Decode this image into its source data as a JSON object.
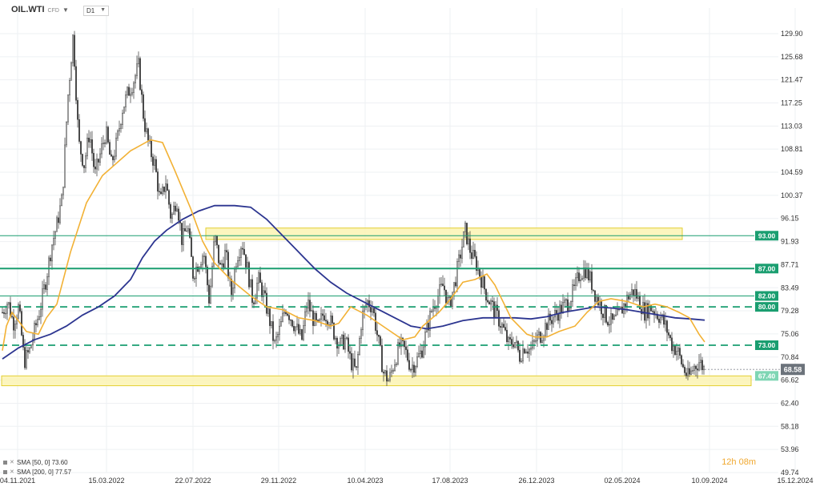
{
  "header": {
    "symbol": "OIL.WTI",
    "symbol_sub": "CFD",
    "timeframe": "D1"
  },
  "indicators": [
    {
      "label": "SMA [50, 0] 73.60",
      "color": "#f2b134"
    },
    {
      "label": "SMA [200, 0] 77.57",
      "color": "#2c3590"
    }
  ],
  "timer": "12h 08m",
  "colors": {
    "candles": "#333333",
    "sma50": "#f2b134",
    "sma200": "#2c3590",
    "level_line": "#1a9e70",
    "zone_fill": "#fbf3b3",
    "zone_border": "#e3cf34"
  },
  "chart_data": {
    "type": "candlestick",
    "title": "",
    "y_ticks": [
      "129.90",
      "125.68",
      "121.47",
      "117.25",
      "113.03",
      "108.81",
      "104.59",
      "100.37",
      "96.15",
      "91.93",
      "87.71",
      "83.49",
      "79.28",
      "75.06",
      "70.84",
      "66.62",
      "62.40",
      "58.18",
      "53.96",
      "49.74"
    ],
    "x_ticks": [
      "04.11.2021",
      "15.03.2022",
      "22.07.2022",
      "29.11.2022",
      "10.04.2023",
      "17.08.2023",
      "26.12.2023",
      "02.05.2024",
      "10.09.2024",
      "15.12.2024"
    ],
    "ylim": [
      49.74,
      131.5
    ],
    "price_levels": [
      {
        "label": "93.00",
        "value": 93.0,
        "style": "solid-thin"
      },
      {
        "label": "87.00",
        "value": 87.0,
        "style": "solid-thick"
      },
      {
        "label": "82.00",
        "value": 82.0,
        "style": "solid-thin"
      },
      {
        "label": "80.00",
        "value": 80.0,
        "style": "dashed"
      },
      {
        "label": "73.00",
        "value": 73.0,
        "style": "dashed"
      },
      {
        "label": "67.40",
        "value": 67.4,
        "style": "zone-top"
      }
    ],
    "current_price": "68.58",
    "zones": [
      {
        "from": 92.3,
        "to": 94.4,
        "start": "2022-07",
        "end": "2024-10"
      },
      {
        "from": 65.6,
        "to": 67.4,
        "start": "2021-11",
        "end": "2024-11"
      }
    ],
    "close_path": [
      79.0,
      81.0,
      77.0,
      80.0,
      70.0,
      72.0,
      76.0,
      80.0,
      85.0,
      91.0,
      95.0,
      100.0,
      118.0,
      129.9,
      110.0,
      106.0,
      112.0,
      104.0,
      108.0,
      112.0,
      106.0,
      110.0,
      116.0,
      119.0,
      121.0,
      124.0,
      114.0,
      109.0,
      106.0,
      99.0,
      103.0,
      96.0,
      100.0,
      92.0,
      95.0,
      86.0,
      88.0,
      90.0,
      81.0,
      93.0,
      87.0,
      90.0,
      82.0,
      89.0,
      92.0,
      87.0,
      81.0,
      85.0,
      82.0,
      78.0,
      73.0,
      76.0,
      80.0,
      78.0,
      76.0,
      74.0,
      81.0,
      78.0,
      76.0,
      79.0,
      78.0,
      75.0,
      73.0,
      74.0,
      70.0,
      68.0,
      78.0,
      81.0,
      80.0,
      74.0,
      68.0,
      66.5,
      70.0,
      73.0,
      72.0,
      69.0,
      70.0,
      72.0,
      76.0,
      80.0,
      82.0,
      84.0,
      80.0,
      84.0,
      89.0,
      94.0,
      90.0,
      88.0,
      85.0,
      82.0,
      80.0,
      78.0,
      76.0,
      73.0,
      74.0,
      71.0,
      73.0,
      72.0,
      74.0,
      75.0,
      77.0,
      78.0,
      79.0,
      80.0,
      81.0,
      83.0,
      86.0,
      87.0,
      85.0,
      82.0,
      80.0,
      78.0,
      77.0,
      78.0,
      80.0,
      82.0,
      83.0,
      81.0,
      79.0,
      80.0,
      79.0,
      78.0,
      76.0,
      73.0,
      72.0,
      69.0,
      67.0,
      69.0,
      70.0,
      68.6
    ],
    "sma50": [
      [
        0,
        72.0
      ],
      [
        5,
        76.5
      ],
      [
        12,
        79.0
      ],
      [
        25,
        76.5
      ],
      [
        30,
        75.5
      ],
      [
        45,
        75.0
      ],
      [
        55,
        78.0
      ],
      [
        68,
        80.5
      ],
      [
        85,
        90.0
      ],
      [
        105,
        99.0
      ],
      [
        125,
        104.0
      ],
      [
        160,
        108.5
      ],
      [
        185,
        110.5
      ],
      [
        200,
        110.0
      ],
      [
        215,
        105.0
      ],
      [
        235,
        98.0
      ],
      [
        250,
        92.0
      ],
      [
        265,
        88.0
      ],
      [
        285,
        85.0
      ],
      [
        310,
        82.0
      ],
      [
        330,
        80.0
      ],
      [
        350,
        79.5
      ],
      [
        370,
        78.0
      ],
      [
        390,
        77.5
      ],
      [
        410,
        76.5
      ],
      [
        420,
        77.0
      ],
      [
        435,
        80.0
      ],
      [
        455,
        78.5
      ],
      [
        480,
        76.0
      ],
      [
        500,
        74.0
      ],
      [
        515,
        74.5
      ],
      [
        525,
        76.5
      ],
      [
        545,
        79.0
      ],
      [
        560,
        81.5
      ],
      [
        575,
        84.5
      ],
      [
        590,
        85.0
      ],
      [
        605,
        86.0
      ],
      [
        615,
        84.0
      ],
      [
        625,
        81.0
      ],
      [
        635,
        78.0
      ],
      [
        645,
        76.5
      ],
      [
        655,
        75.0
      ],
      [
        665,
        74.5
      ],
      [
        680,
        74.5
      ],
      [
        695,
        75.5
      ],
      [
        715,
        76.5
      ],
      [
        730,
        79.0
      ],
      [
        745,
        81.0
      ],
      [
        760,
        81.5
      ],
      [
        780,
        81.0
      ],
      [
        800,
        80.0
      ],
      [
        815,
        80.5
      ],
      [
        830,
        80.0
      ],
      [
        845,
        79.0
      ],
      [
        858,
        78.0
      ],
      [
        870,
        75.0
      ],
      [
        877,
        73.6
      ]
    ],
    "sma200": [
      [
        0,
        70.5
      ],
      [
        20,
        72.5
      ],
      [
        40,
        74.0
      ],
      [
        60,
        75.0
      ],
      [
        80,
        76.5
      ],
      [
        100,
        78.5
      ],
      [
        120,
        80.0
      ],
      [
        140,
        82.0
      ],
      [
        160,
        85.0
      ],
      [
        175,
        89.0
      ],
      [
        190,
        92.0
      ],
      [
        205,
        94.0
      ],
      [
        225,
        96.0
      ],
      [
        245,
        97.5
      ],
      [
        265,
        98.5
      ],
      [
        290,
        98.5
      ],
      [
        310,
        98.2
      ],
      [
        330,
        96.0
      ],
      [
        350,
        93.0
      ],
      [
        370,
        90.0
      ],
      [
        390,
        87.0
      ],
      [
        410,
        84.5
      ],
      [
        430,
        82.5
      ],
      [
        450,
        81.0
      ],
      [
        470,
        79.5
      ],
      [
        490,
        78.0
      ],
      [
        510,
        76.5
      ],
      [
        530,
        76.0
      ],
      [
        550,
        76.5
      ],
      [
        575,
        77.5
      ],
      [
        600,
        78.0
      ],
      [
        620,
        78.0
      ],
      [
        640,
        78.0
      ],
      [
        660,
        77.8
      ],
      [
        680,
        78.2
      ],
      [
        700,
        79.0
      ],
      [
        720,
        79.5
      ],
      [
        740,
        80.0
      ],
      [
        760,
        79.8
      ],
      [
        780,
        79.5
      ],
      [
        800,
        79.0
      ],
      [
        820,
        78.5
      ],
      [
        840,
        78.0
      ],
      [
        860,
        77.8
      ],
      [
        877,
        77.57
      ]
    ]
  }
}
